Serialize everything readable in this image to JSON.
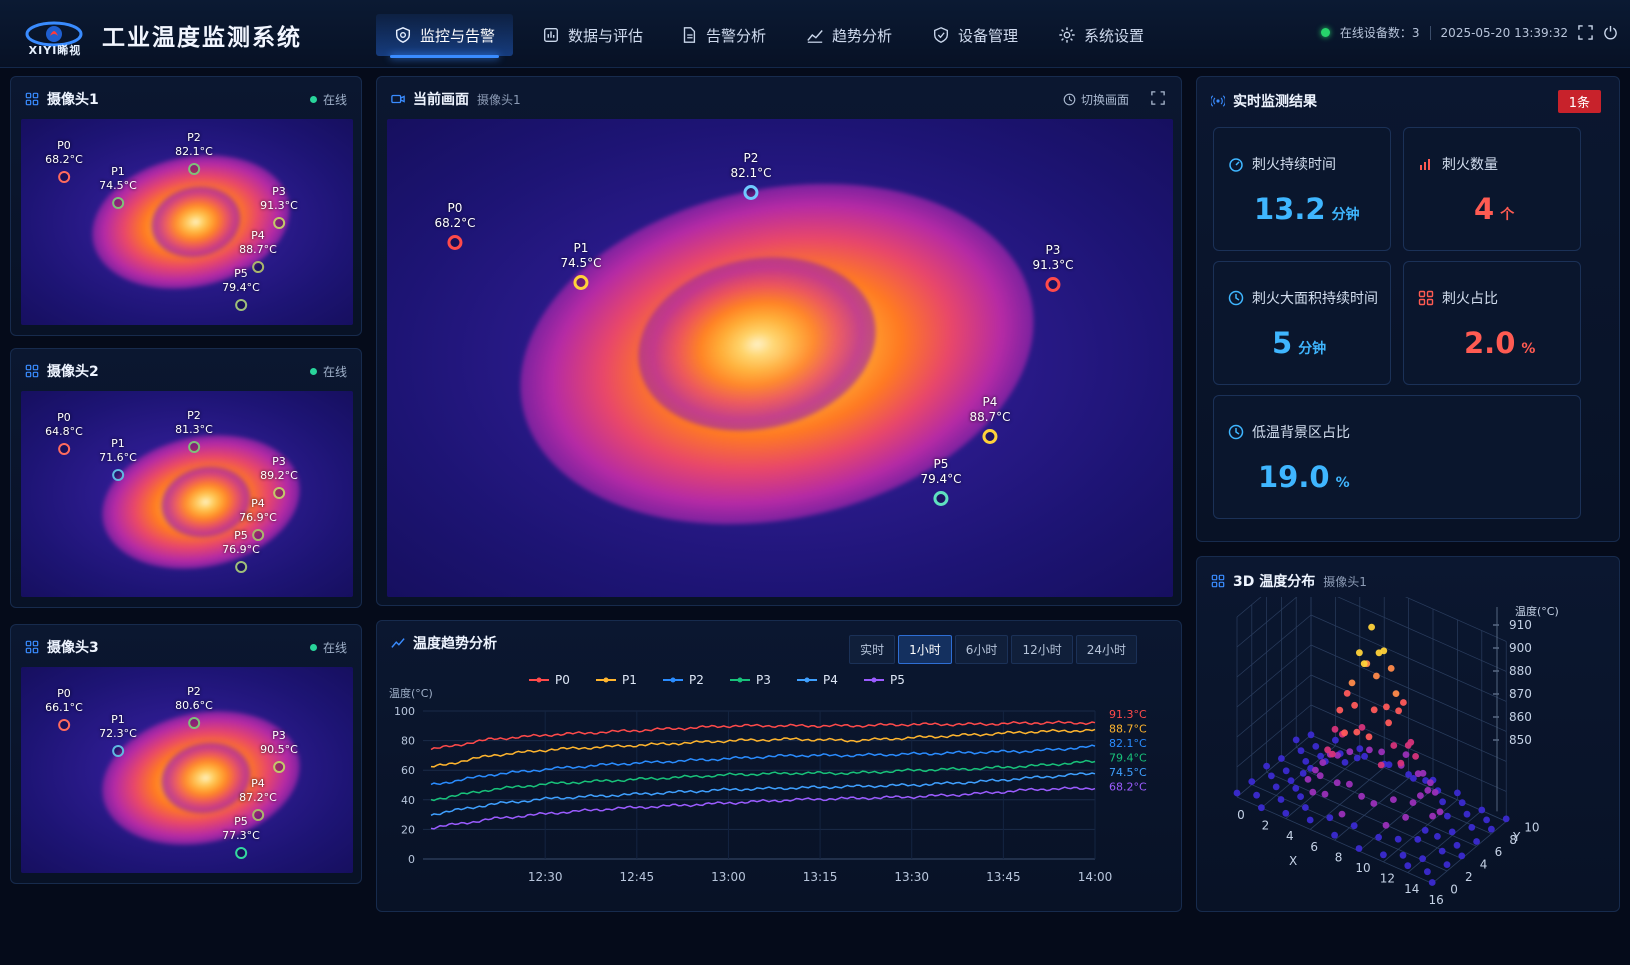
{
  "header": {
    "logo_text": "XIYI睎视",
    "title": "工业温度监测系统",
    "nav": [
      {
        "label": "监控与告警",
        "icon": "shield-camera-icon"
      },
      {
        "label": "数据与评估",
        "icon": "data-panel-icon"
      },
      {
        "label": "告警分析",
        "icon": "document-icon"
      },
      {
        "label": "趋势分析",
        "icon": "trend-area-icon"
      },
      {
        "label": "设备管理",
        "icon": "shield-check-icon"
      },
      {
        "label": "系统设置",
        "icon": "gear-icon"
      }
    ],
    "online_devices": "在线设备数：3",
    "datetime": "2025-05-20  13:39:32"
  },
  "cameras": [
    {
      "title": "摄像头1",
      "status": "在线",
      "points": [
        {
          "name": "P0",
          "temp": "68.2°C",
          "color": "#ff6b5e"
        },
        {
          "name": "P1",
          "temp": "74.5°C",
          "color": "#7fc17a"
        },
        {
          "name": "P2",
          "temp": "82.1°C",
          "color": "#7fc17a"
        },
        {
          "name": "P3",
          "temp": "91.3°C",
          "color": "#c3c86a"
        },
        {
          "name": "P4",
          "temp": "88.7°C",
          "color": "#a9b56d"
        },
        {
          "name": "P5",
          "temp": "79.4°C",
          "color": "#9fbf7a"
        }
      ]
    },
    {
      "title": "摄像头2",
      "status": "在线",
      "points": [
        {
          "name": "P0",
          "temp": "64.8°C",
          "color": "#ff6b5e"
        },
        {
          "name": "P1",
          "temp": "71.6°C",
          "color": "#5fb9e0"
        },
        {
          "name": "P2",
          "temp": "81.3°C",
          "color": "#7fc17a"
        },
        {
          "name": "P3",
          "temp": "89.2°C",
          "color": "#c3c86a"
        },
        {
          "name": "P4",
          "temp": "76.9°C",
          "color": "#a9b56d"
        },
        {
          "name": "P5",
          "temp": "76.9°C",
          "color": "#9fbf7a"
        }
      ]
    },
    {
      "title": "摄像头3",
      "status": "在线",
      "points": [
        {
          "name": "P0",
          "temp": "66.1°C",
          "color": "#ff6b5e"
        },
        {
          "name": "P1",
          "temp": "72.3°C",
          "color": "#5fb9e0"
        },
        {
          "name": "P2",
          "temp": "80.6°C",
          "color": "#7fc17a"
        },
        {
          "name": "P3",
          "temp": "90.5°C",
          "color": "#c3c86a"
        },
        {
          "name": "P4",
          "temp": "87.2°C",
          "color": "#a9b56d"
        },
        {
          "name": "P5",
          "temp": "77.3°C",
          "color": "#34d9a0"
        }
      ]
    }
  ],
  "main_view": {
    "title": "当前画面",
    "subtitle": "摄像头1",
    "switch_label": "切换画面",
    "points": [
      {
        "name": "P0",
        "temp": "68.2°C",
        "color": "#ff4a4a"
      },
      {
        "name": "P1",
        "temp": "74.5°C",
        "color": "#ffd23a"
      },
      {
        "name": "P2",
        "temp": "82.1°C",
        "color": "#6fc9ff"
      },
      {
        "name": "P3",
        "temp": "91.3°C",
        "color": "#ff4a4a"
      },
      {
        "name": "P4",
        "temp": "88.7°C",
        "color": "#ffd23a"
      },
      {
        "name": "P5",
        "temp": "79.4°C",
        "color": "#5fe0c0"
      }
    ]
  },
  "results": {
    "title": "实时监测结果",
    "badge": "1条",
    "metrics": [
      {
        "label": "刺火持续时间",
        "value": "13.2",
        "unit": "分钟",
        "tone": "blue",
        "icon": "timer-icon"
      },
      {
        "label": "刺火数量",
        "value": "4",
        "unit": "个",
        "tone": "red",
        "icon": "bar-chart-icon"
      },
      {
        "label": "刺火大面积持续时间",
        "value": "5",
        "unit": "分钟",
        "tone": "blue",
        "icon": "clock-icon"
      },
      {
        "label": "刺火占比",
        "value": "2.0",
        "unit": "%",
        "tone": "red",
        "icon": "grid-icon"
      },
      {
        "label": "低温背景区占比",
        "value": "19.0",
        "unit": "%",
        "tone": "blue",
        "icon": "clock-icon"
      }
    ]
  },
  "trend": {
    "title": "温度趋势分析",
    "ranges": [
      "实时",
      "1小时",
      "6小时",
      "12小时",
      "24小时"
    ],
    "active_range": "1小时"
  },
  "dist3d": {
    "title": "3D 温度分布",
    "subtitle": "摄像头1",
    "z_label": "温度(°C)",
    "z_ticks": [
      "910",
      "900",
      "880",
      "870",
      "860",
      "850"
    ],
    "x_ticks": [
      "0",
      "2",
      "4",
      "6",
      "8",
      "10",
      "12",
      "14",
      "16"
    ],
    "y_ticks": [
      "0",
      "2",
      "4",
      "6",
      "8",
      "10"
    ],
    "x_label": "X",
    "y_label": "Y"
  },
  "colors": {
    "accent": "#3a8cff",
    "danger": "#c8222b",
    "metric_blue": "#3fb6ff",
    "metric_red": "#ff5b52"
  },
  "chart_data": {
    "type": "line",
    "title": "温度趋势分析",
    "ylabel": "温度(°C)",
    "xlabel": "",
    "ylim": [
      0,
      100
    ],
    "y_ticks": [
      0,
      20,
      40,
      60,
      80,
      100
    ],
    "x_ticks": [
      "12:30",
      "12:45",
      "13:00",
      "13:15",
      "13:30",
      "13:45",
      "14:00"
    ],
    "x": [
      "12:10",
      "12:20",
      "12:30",
      "12:40",
      "12:50",
      "13:00",
      "13:10",
      "13:20",
      "13:30",
      "13:40",
      "13:50",
      "14:00"
    ],
    "grid": true,
    "legend": "top-center",
    "series": [
      {
        "name": "P0",
        "color": "#ff4a4a",
        "end_label": "91.3°C",
        "values": [
          74,
          81,
          84,
          86,
          88,
          90,
          90,
          90,
          91,
          91,
          92,
          92
        ]
      },
      {
        "name": "P1",
        "color": "#ffb52e",
        "end_label": "88.7°C",
        "values": [
          62,
          70,
          74,
          76,
          78,
          80,
          81,
          80,
          82,
          84,
          86,
          87
        ]
      },
      {
        "name": "P2",
        "color": "#2a8cff",
        "end_label": "82.1°C",
        "values": [
          50,
          57,
          61,
          64,
          66,
          68,
          70,
          70,
          71,
          72,
          73,
          76
        ]
      },
      {
        "name": "P3",
        "color": "#18c27a",
        "end_label": "79.4°C",
        "values": [
          40,
          47,
          51,
          53,
          55,
          57,
          58,
          58,
          60,
          61,
          63,
          66
        ]
      },
      {
        "name": "P4",
        "color": "#3fa0ff",
        "end_label": "74.5°C",
        "values": [
          30,
          37,
          41,
          43,
          45,
          47,
          48,
          49,
          50,
          52,
          55,
          58
        ]
      },
      {
        "name": "P5",
        "color": "#9b5cff",
        "end_label": "68.2°C",
        "values": [
          21,
          27,
          31,
          34,
          36,
          38,
          40,
          41,
          42,
          44,
          47,
          48
        ]
      }
    ]
  }
}
